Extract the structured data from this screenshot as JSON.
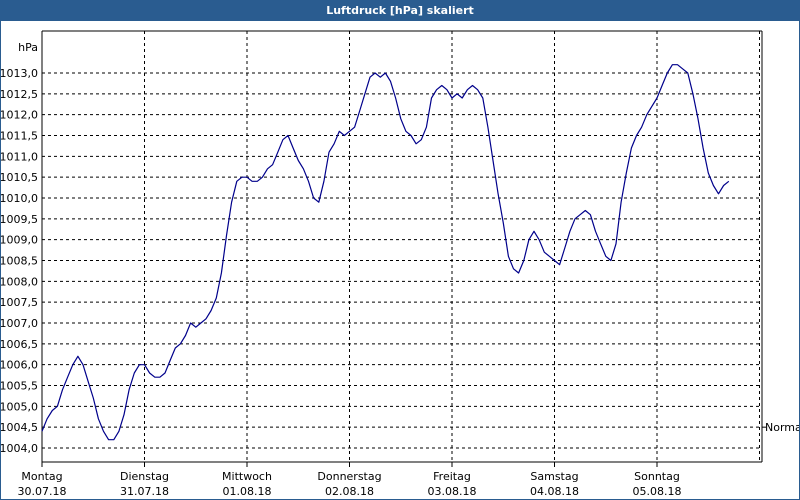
{
  "chart_data": {
    "type": "line",
    "title": "Luftdruck [hPa] skaliert",
    "ylabel": "hPa",
    "ylim": [
      1004.0,
      1013.3
    ],
    "yticks": [
      "1004,0",
      "1004,5",
      "1005,0",
      "1005,5",
      "1006,0",
      "1006,5",
      "1007,0",
      "1007,5",
      "1008,0",
      "1008,5",
      "1009,0",
      "1009,5",
      "1010,0",
      "1010,5",
      "1011,0",
      "1011,5",
      "1012,0",
      "1012,5",
      "1013,0"
    ],
    "days": [
      {
        "name": "Montag",
        "date": "30.07.18"
      },
      {
        "name": "Dienstag",
        "date": "31.07.18"
      },
      {
        "name": "Mittwoch",
        "date": "01.08.18"
      },
      {
        "name": "Donnerstag",
        "date": "02.08.18"
      },
      {
        "name": "Freitag",
        "date": "03.08.18"
      },
      {
        "name": "Samstag",
        "date": "04.08.18"
      },
      {
        "name": "Sonntag",
        "date": "05.08.18"
      }
    ],
    "reference_line": {
      "label": "Normal",
      "value": 1004.5
    },
    "grid": true,
    "line_color": "#00008b",
    "series": [
      {
        "x_unit": "day",
        "points": [
          [
            0.0,
            1004.4
          ],
          [
            0.05,
            1004.7
          ],
          [
            0.1,
            1004.9
          ],
          [
            0.15,
            1005.0
          ],
          [
            0.2,
            1005.4
          ],
          [
            0.25,
            1005.7
          ],
          [
            0.3,
            1006.0
          ],
          [
            0.35,
            1006.2
          ],
          [
            0.4,
            1006.0
          ],
          [
            0.45,
            1005.6
          ],
          [
            0.5,
            1005.2
          ],
          [
            0.55,
            1004.7
          ],
          [
            0.6,
            1004.4
          ],
          [
            0.65,
            1004.2
          ],
          [
            0.7,
            1004.2
          ],
          [
            0.75,
            1004.4
          ],
          [
            0.8,
            1004.8
          ],
          [
            0.85,
            1005.4
          ],
          [
            0.9,
            1005.8
          ],
          [
            0.95,
            1006.0
          ],
          [
            1.0,
            1006.0
          ],
          [
            1.05,
            1005.8
          ],
          [
            1.1,
            1005.7
          ],
          [
            1.15,
            1005.7
          ],
          [
            1.2,
            1005.8
          ],
          [
            1.25,
            1006.1
          ],
          [
            1.3,
            1006.4
          ],
          [
            1.35,
            1006.5
          ],
          [
            1.4,
            1006.7
          ],
          [
            1.45,
            1007.0
          ],
          [
            1.5,
            1006.9
          ],
          [
            1.55,
            1007.0
          ],
          [
            1.6,
            1007.1
          ],
          [
            1.65,
            1007.3
          ],
          [
            1.7,
            1007.6
          ],
          [
            1.75,
            1008.2
          ],
          [
            1.8,
            1009.1
          ],
          [
            1.85,
            1009.9
          ],
          [
            1.9,
            1010.4
          ],
          [
            1.95,
            1010.5
          ],
          [
            2.0,
            1010.5
          ],
          [
            2.05,
            1010.4
          ],
          [
            2.1,
            1010.4
          ],
          [
            2.15,
            1010.5
          ],
          [
            2.2,
            1010.7
          ],
          [
            2.25,
            1010.8
          ],
          [
            2.3,
            1011.1
          ],
          [
            2.35,
            1011.4
          ],
          [
            2.4,
            1011.5
          ],
          [
            2.45,
            1011.2
          ],
          [
            2.5,
            1010.9
          ],
          [
            2.55,
            1010.7
          ],
          [
            2.6,
            1010.4
          ],
          [
            2.65,
            1010.0
          ],
          [
            2.7,
            1009.9
          ],
          [
            2.75,
            1010.4
          ],
          [
            2.8,
            1011.1
          ],
          [
            2.85,
            1011.3
          ],
          [
            2.9,
            1011.6
          ],
          [
            2.95,
            1011.5
          ],
          [
            3.0,
            1011.6
          ],
          [
            3.05,
            1011.7
          ],
          [
            3.1,
            1012.1
          ],
          [
            3.15,
            1012.5
          ],
          [
            3.2,
            1012.9
          ],
          [
            3.25,
            1013.0
          ],
          [
            3.3,
            1012.9
          ],
          [
            3.35,
            1013.0
          ],
          [
            3.4,
            1012.8
          ],
          [
            3.45,
            1012.4
          ],
          [
            3.5,
            1011.9
          ],
          [
            3.55,
            1011.6
          ],
          [
            3.6,
            1011.5
          ],
          [
            3.65,
            1011.3
          ],
          [
            3.7,
            1011.4
          ],
          [
            3.75,
            1011.7
          ],
          [
            3.8,
            1012.4
          ],
          [
            3.85,
            1012.6
          ],
          [
            3.9,
            1012.7
          ],
          [
            3.95,
            1012.6
          ],
          [
            4.0,
            1012.4
          ],
          [
            4.05,
            1012.5
          ],
          [
            4.1,
            1012.4
          ],
          [
            4.15,
            1012.6
          ],
          [
            4.2,
            1012.7
          ],
          [
            4.25,
            1012.6
          ],
          [
            4.3,
            1012.4
          ],
          [
            4.35,
            1011.7
          ],
          [
            4.4,
            1010.9
          ],
          [
            4.45,
            1010.1
          ],
          [
            4.5,
            1009.4
          ],
          [
            4.55,
            1008.6
          ],
          [
            4.6,
            1008.3
          ],
          [
            4.65,
            1008.2
          ],
          [
            4.7,
            1008.5
          ],
          [
            4.75,
            1009.0
          ],
          [
            4.8,
            1009.2
          ],
          [
            4.85,
            1009.0
          ],
          [
            4.9,
            1008.7
          ],
          [
            4.95,
            1008.6
          ],
          [
            5.0,
            1008.5
          ],
          [
            5.05,
            1008.4
          ],
          [
            5.1,
            1008.8
          ],
          [
            5.15,
            1009.2
          ],
          [
            5.2,
            1009.5
          ],
          [
            5.25,
            1009.6
          ],
          [
            5.3,
            1009.7
          ],
          [
            5.35,
            1009.6
          ],
          [
            5.4,
            1009.2
          ],
          [
            5.45,
            1008.9
          ],
          [
            5.5,
            1008.6
          ],
          [
            5.55,
            1008.5
          ],
          [
            5.6,
            1008.9
          ],
          [
            5.65,
            1009.9
          ],
          [
            5.7,
            1010.6
          ],
          [
            5.75,
            1011.2
          ],
          [
            5.8,
            1011.5
          ],
          [
            5.85,
            1011.7
          ],
          [
            5.9,
            1012.0
          ],
          [
            5.95,
            1012.2
          ],
          [
            6.0,
            1012.4
          ],
          [
            6.05,
            1012.7
          ],
          [
            6.1,
            1013.0
          ],
          [
            6.15,
            1013.2
          ],
          [
            6.2,
            1013.2
          ],
          [
            6.25,
            1013.1
          ],
          [
            6.3,
            1013.0
          ],
          [
            6.35,
            1012.5
          ],
          [
            6.4,
            1011.9
          ],
          [
            6.45,
            1011.2
          ],
          [
            6.5,
            1010.6
          ],
          [
            6.55,
            1010.3
          ],
          [
            6.6,
            1010.1
          ],
          [
            6.65,
            1010.3
          ],
          [
            6.7,
            1010.4
          ]
        ]
      }
    ]
  }
}
